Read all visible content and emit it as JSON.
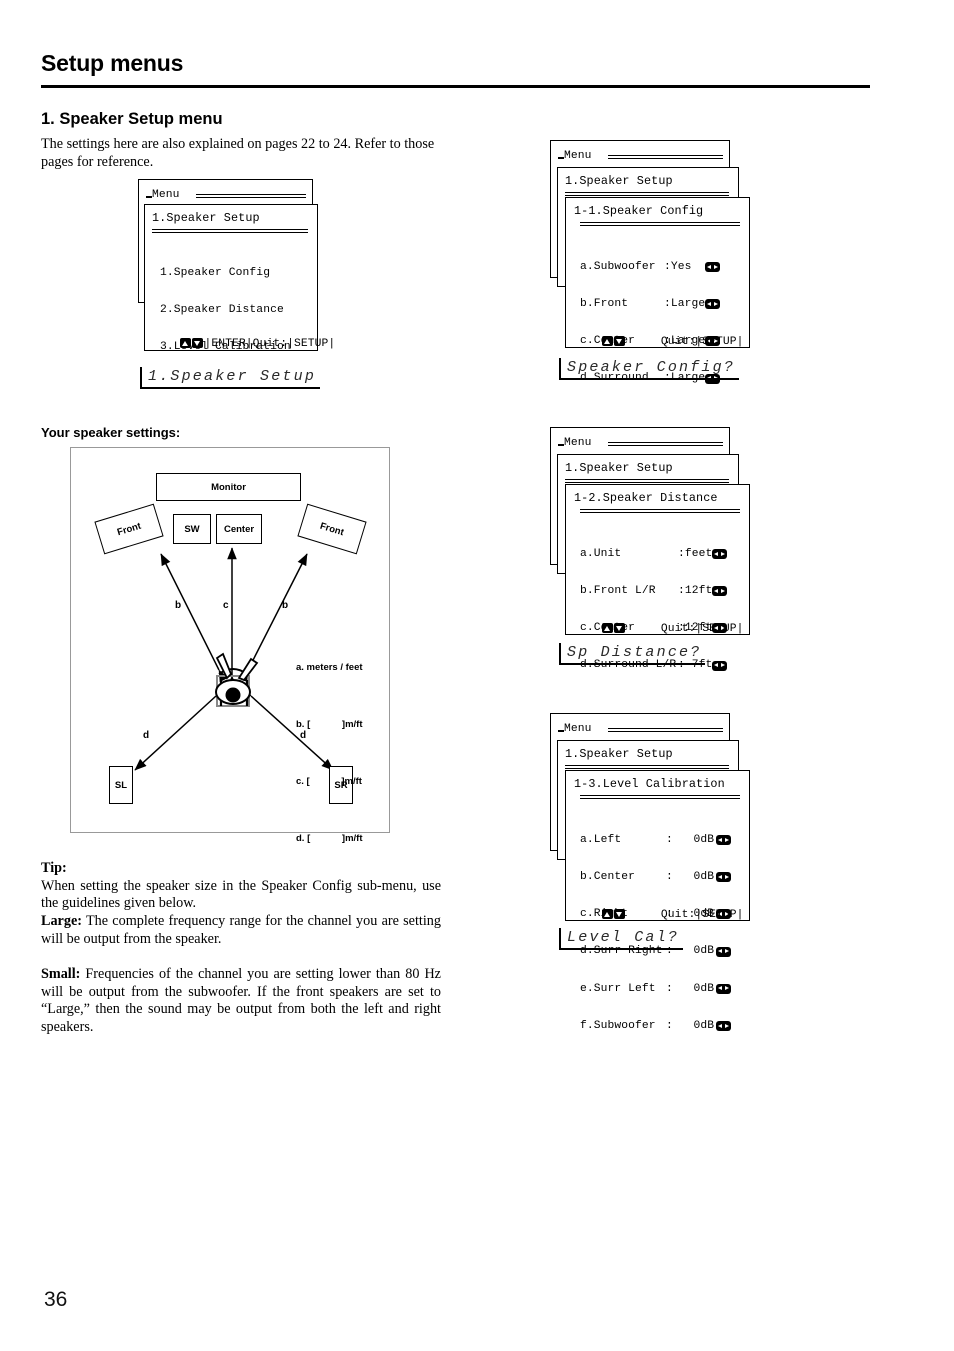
{
  "header": {
    "title": "Setup menus",
    "page_number": "36"
  },
  "left": {
    "section_title": "1. Speaker Setup menu",
    "intro": "The settings here are also explained on pages 22 to 24. Refer to those pages for reference.",
    "your_settings_label": "Your speaker settings:",
    "tip": {
      "heading": "Tip:",
      "body": "When setting the speaker size in the Speaker Config sub-menu, use the guidelines given below.",
      "large_label": "Large:",
      "large_body": " The complete frequency range for the channel you are setting will be output from the speaker.",
      "small_label": "Small:",
      "small_body": " Frequencies of the channel you are setting lower than 80 Hz will be output from the subwoofer. If the front speakers are set to “Large,” then the sound may be output from both the left and right speakers."
    }
  },
  "diagram": {
    "monitor": "Monitor",
    "front_left": "Front",
    "front_right": "Front",
    "sw": "SW",
    "center": "Center",
    "surround_left": "SL",
    "surround_right": "SR",
    "arrow_labels": {
      "b_left": "b",
      "c": "c",
      "b_right": "b",
      "d_left": "d",
      "d_right": "d"
    },
    "legend": [
      "a. meters / feet",
      "b. [            ]m/ft",
      "c. [            ]m/ft",
      "d. [            ]m/ft"
    ]
  },
  "menus": [
    {
      "id": "speaker-setup",
      "menu_label": "Menu",
      "parent_title": "1.Speaker Setup",
      "title": null,
      "rows": [
        {
          "label": "1.Speaker Config",
          "value": "",
          "arrow": false
        },
        {
          "label": "2.Speaker Distance",
          "value": "",
          "arrow": false
        },
        {
          "label": "3.Level Calibration",
          "value": "",
          "arrow": false
        }
      ],
      "footer": "|ENTER|Quit:|SETUP|",
      "lcd": "1.Speaker Setup"
    },
    {
      "id": "speaker-config",
      "menu_label": "Menu",
      "parent_title": "1.Speaker Setup",
      "title": "1-1.Speaker Config",
      "rows": [
        {
          "label": "a.Subwoofer",
          "value": ":Yes",
          "arrow": true
        },
        {
          "label": "b.Front",
          "value": ":Large",
          "arrow": true
        },
        {
          "label": "c.Center",
          "value": ":Large",
          "arrow": true
        },
        {
          "label": "d.Surround",
          "value": ":Large",
          "arrow": true
        }
      ],
      "footer": "     Quit:|SETUP|",
      "lcd": "Speaker Config?"
    },
    {
      "id": "speaker-distance",
      "menu_label": "Menu",
      "parent_title": "1.Speaker Setup",
      "title": "1-2.Speaker Distance",
      "rows": [
        {
          "label": "a.Unit",
          "value": ":feet",
          "arrow": true
        },
        {
          "label": "b.Front L/R",
          "value": ":12ft",
          "arrow": true
        },
        {
          "label": "c.Center",
          "value": ":12ft",
          "arrow": true
        },
        {
          "label": "d.Surround L/R",
          "value": ": 7ft",
          "arrow": true
        }
      ],
      "footer": "     Quit:|SETUP|",
      "lcd": "Sp Distance?"
    },
    {
      "id": "level-calibration",
      "menu_label": "Menu",
      "parent_title": "1.Speaker Setup",
      "title": "1-3.Level Calibration",
      "rows": [
        {
          "label": "a.Left",
          "value": ":   0dB",
          "arrow": true
        },
        {
          "label": "b.Center",
          "value": ":   0dB",
          "arrow": true
        },
        {
          "label": "c.Right",
          "value": ":   0dB",
          "arrow": true
        },
        {
          "label": "d.Surr Right",
          "value": ":   0dB",
          "arrow": true
        },
        {
          "label": "e.Surr Left",
          "value": ":   0dB",
          "arrow": true
        },
        {
          "label": "f.Subwoofer",
          "value": ":   0dB",
          "arrow": true
        }
      ],
      "footer": "     Quit:|SETUP|",
      "lcd": "Level Cal?"
    }
  ]
}
